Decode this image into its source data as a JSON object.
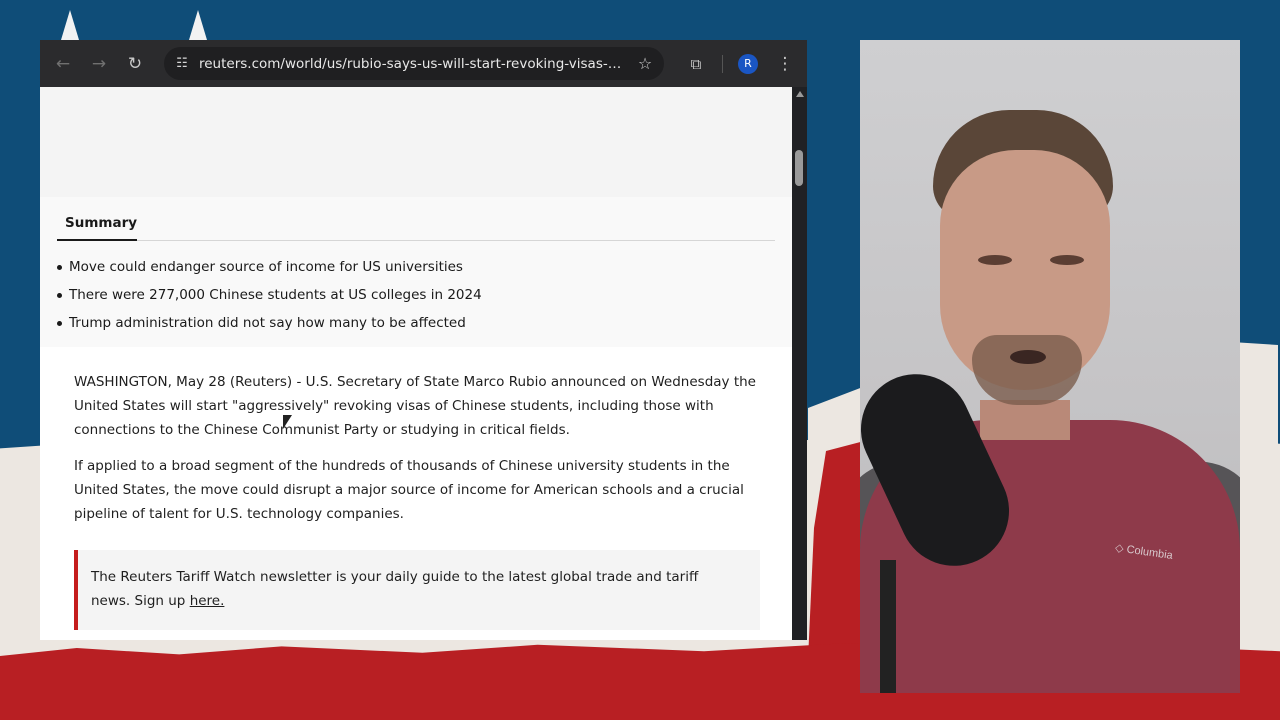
{
  "browser": {
    "nav": {
      "back_icon": "arrow-left-icon",
      "forward_icon": "arrow-right-icon",
      "reload_icon": "reload-icon"
    },
    "address_bar": {
      "url": "reuters.com/world/us/rubio-says-us-will-start-revoking-visas-chine..."
    },
    "profile_initial": "R",
    "colors": {
      "toolbar": "#2b2b2d",
      "accent": "#c41c1c"
    }
  },
  "article": {
    "summary": {
      "tab_label": "Summary",
      "items": [
        "Move could endanger source of income for US universities",
        "There were 277,000 Chinese students at US colleges in 2024",
        "Trump administration did not say how many to be affected"
      ]
    },
    "paragraphs": [
      "WASHINGTON, May 28 (Reuters) - U.S. Secretary of State Marco Rubio announced on Wednesday the United States will start \"aggressively\" revoking visas of Chinese students, including those with connections to the Chinese Communist Party or studying in critical fields.",
      "If applied to a broad segment of the hundreds of thousands of Chinese university students in the United States, the move could disrupt a major source of income for American schools and a crucial pipeline of talent for U.S. technology companies."
    ],
    "newsletter": {
      "text": "The Reuters Tariff Watch newsletter is your daily guide to the latest global trade and tariff news. Sign up ",
      "link_label": "here."
    }
  }
}
